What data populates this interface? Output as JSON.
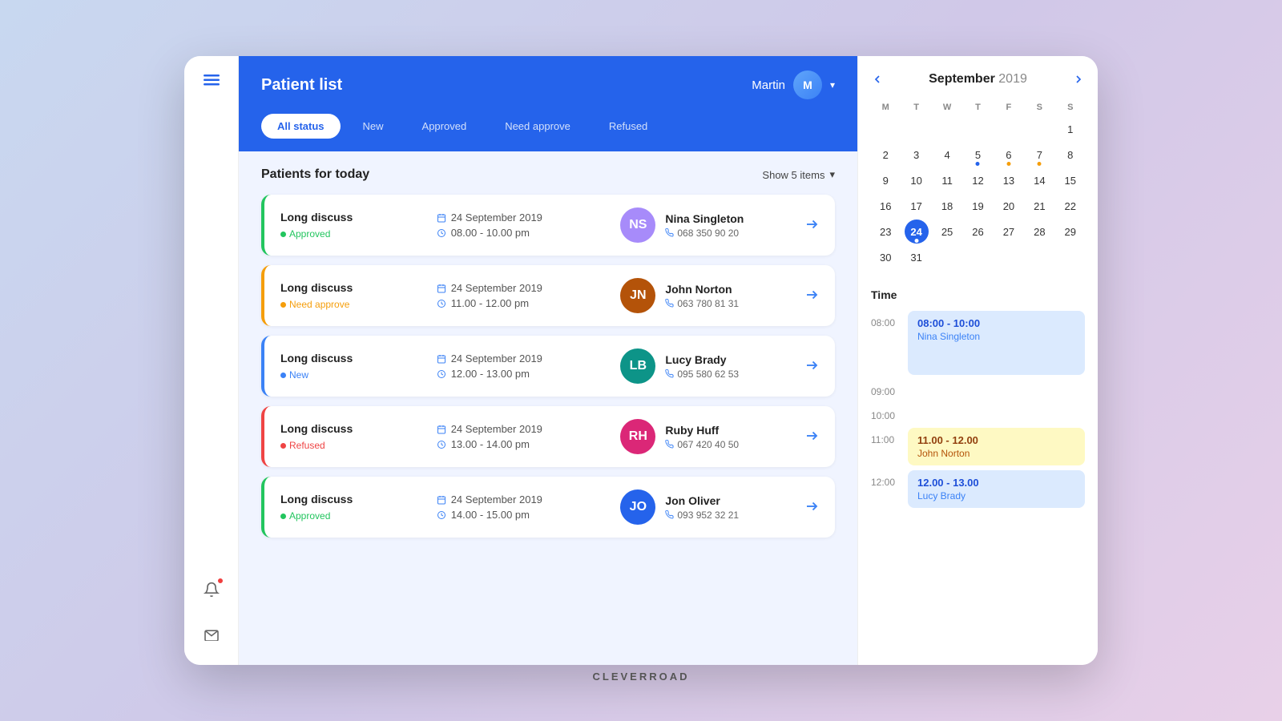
{
  "app": {
    "title": "Patient list",
    "brand": "CLEVERROAD"
  },
  "header": {
    "user_name": "Martin",
    "avatar_initials": "M"
  },
  "filter_tabs": [
    {
      "id": "all",
      "label": "All status",
      "active": true
    },
    {
      "id": "new",
      "label": "New",
      "active": false
    },
    {
      "id": "approved",
      "label": "Approved",
      "active": false
    },
    {
      "id": "need_approve",
      "label": "Need approve",
      "active": false
    },
    {
      "id": "refused",
      "label": "Refused",
      "active": false
    }
  ],
  "section": {
    "title": "Patients for today",
    "show_items_label": "Show 5 items"
  },
  "patients": [
    {
      "type": "Long discuss",
      "status": "Approved",
      "status_key": "approved",
      "date": "24 September 2019",
      "time": "08.00 - 10.00 pm",
      "name": "Nina Singleton",
      "phone": "068 350 90 20",
      "avatar_initials": "NS",
      "avatar_color": "av-purple"
    },
    {
      "type": "Long discuss",
      "status": "Need approve",
      "status_key": "need-approve",
      "date": "24 September 2019",
      "time": "11.00 - 12.00 pm",
      "name": "John Norton",
      "phone": "063 780 81 31",
      "avatar_initials": "JN",
      "avatar_color": "av-brown"
    },
    {
      "type": "Long discuss",
      "status": "New",
      "status_key": "new",
      "date": "24 September 2019",
      "time": "12.00 - 13.00 pm",
      "name": "Lucy Brady",
      "phone": "095 580 62 53",
      "avatar_initials": "LB",
      "avatar_color": "av-teal"
    },
    {
      "type": "Long discuss",
      "status": "Refused",
      "status_key": "refused",
      "date": "24 September 2019",
      "time": "13.00 - 14.00 pm",
      "name": "Ruby Huff",
      "phone": "067 420 40 50",
      "avatar_initials": "RH",
      "avatar_color": "av-pink"
    },
    {
      "type": "Long discuss",
      "status": "Approved",
      "status_key": "approved",
      "date": "24 September 2019",
      "time": "14.00 - 15.00 pm",
      "name": "Jon Oliver",
      "phone": "093 952 32 21",
      "avatar_initials": "JO",
      "avatar_color": "av-blue"
    }
  ],
  "calendar": {
    "month": "September",
    "year": "2019",
    "day_headers": [
      "M",
      "T",
      "W",
      "T",
      "F",
      "S",
      "S"
    ],
    "weeks": [
      [
        null,
        null,
        null,
        null,
        null,
        null,
        null
      ],
      [
        null,
        null,
        null,
        null,
        null,
        null,
        null
      ],
      [
        null,
        null,
        null,
        null,
        null,
        null,
        null
      ],
      [
        null,
        null,
        null,
        null,
        null,
        null,
        null
      ],
      [
        null,
        null,
        null,
        null,
        null,
        null,
        null
      ]
    ],
    "days": [
      {
        "n": 1,
        "dot": false
      },
      {
        "n": 2,
        "dot": false
      },
      {
        "n": 3,
        "dot": false
      },
      {
        "n": 4,
        "dot": false
      },
      {
        "n": 5,
        "dot": true,
        "dot_color": "blue"
      },
      {
        "n": 6,
        "dot": true,
        "dot_color": "orange"
      },
      {
        "n": 7,
        "dot": true,
        "dot_color": "orange"
      },
      {
        "n": 8,
        "dot": false
      },
      {
        "n": 9,
        "dot": false
      },
      {
        "n": 10,
        "dot": false
      },
      {
        "n": 11,
        "dot": false
      },
      {
        "n": 12,
        "dot": false
      },
      {
        "n": 13,
        "dot": false
      },
      {
        "n": 14,
        "dot": false
      },
      {
        "n": 15,
        "dot": false
      },
      {
        "n": 16,
        "dot": false
      },
      {
        "n": 17,
        "dot": false
      },
      {
        "n": 18,
        "dot": false
      },
      {
        "n": 19,
        "dot": false
      },
      {
        "n": 20,
        "dot": false
      },
      {
        "n": 21,
        "dot": false
      },
      {
        "n": 22,
        "dot": false
      },
      {
        "n": 23,
        "dot": false
      },
      {
        "n": 24,
        "today": true
      },
      {
        "n": 25,
        "dot": false
      },
      {
        "n": 26,
        "dot": false
      },
      {
        "n": 27,
        "dot": false
      },
      {
        "n": 28,
        "dot": false
      },
      {
        "n": 29,
        "dot": false
      },
      {
        "n": 30,
        "dot": false
      },
      {
        "n": 31,
        "dot": false
      }
    ],
    "time_label": "Time"
  },
  "schedule": [
    {
      "time": "08:00",
      "events": [
        {
          "title": "08:00 - 10:00",
          "name": "Nina Singleton",
          "color": "blue",
          "start": "08:00"
        }
      ]
    },
    {
      "time": "09:00",
      "events": []
    },
    {
      "time": "10:00",
      "events": []
    },
    {
      "time": "11:00",
      "events": [
        {
          "title": "11.00 - 12.00",
          "name": "John Norton",
          "color": "yellow",
          "start": "11:00"
        }
      ]
    },
    {
      "time": "12:00",
      "events": [
        {
          "title": "12.00 - 13.00",
          "name": "Lucy Brady",
          "color": "blue",
          "start": "12:00"
        }
      ]
    }
  ],
  "sidebar": {
    "menu_label": "☰",
    "notification_icon": "🔔",
    "mail_icon": "✉"
  }
}
